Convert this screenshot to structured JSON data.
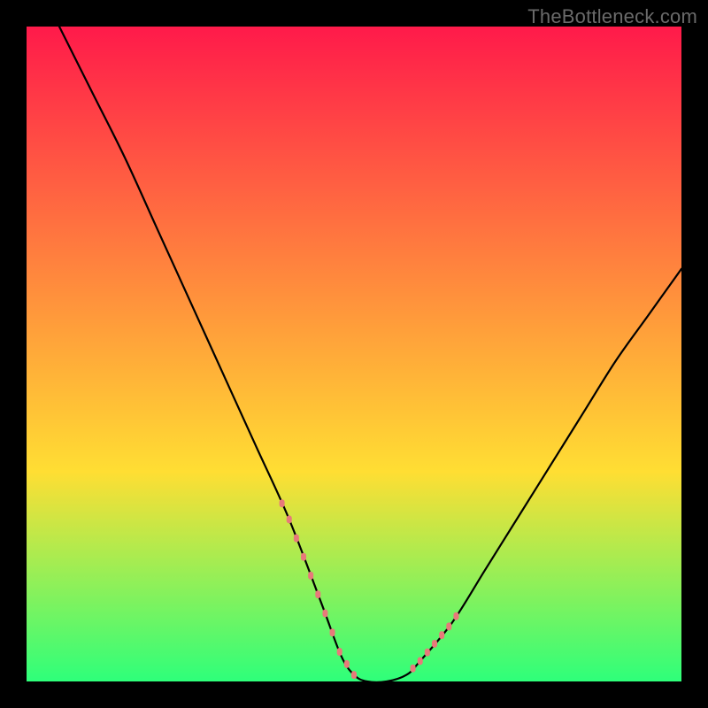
{
  "watermark": "TheBottleneck.com",
  "chart_data": {
    "type": "line",
    "title": "",
    "xlabel": "",
    "ylabel": "",
    "xlim": [
      0,
      100
    ],
    "ylim": [
      0,
      100
    ],
    "grid": false,
    "background_gradient": {
      "top_color": "#ff1a4a",
      "mid_color": "#ffde33",
      "bottom_color": "#2eff7a"
    },
    "series": [
      {
        "name": "bottleneck-curve",
        "color": "#000000",
        "x": [
          5,
          10,
          15,
          20,
          25,
          30,
          35,
          40,
          45,
          48,
          50,
          52,
          55,
          58,
          60,
          65,
          70,
          75,
          80,
          85,
          90,
          95,
          100
        ],
        "values": [
          100,
          90,
          80,
          69,
          58,
          47,
          36,
          25,
          12,
          4,
          1,
          0,
          0,
          1,
          3,
          9,
          17,
          25,
          33,
          41,
          49,
          56,
          63
        ]
      }
    ],
    "marker_regions": [
      {
        "x_range": [
          39,
          50
        ],
        "color": "#e77a7a",
        "style": "dotted"
      },
      {
        "x_range": [
          59,
          66
        ],
        "color": "#e77a7a",
        "style": "dotted"
      }
    ]
  }
}
